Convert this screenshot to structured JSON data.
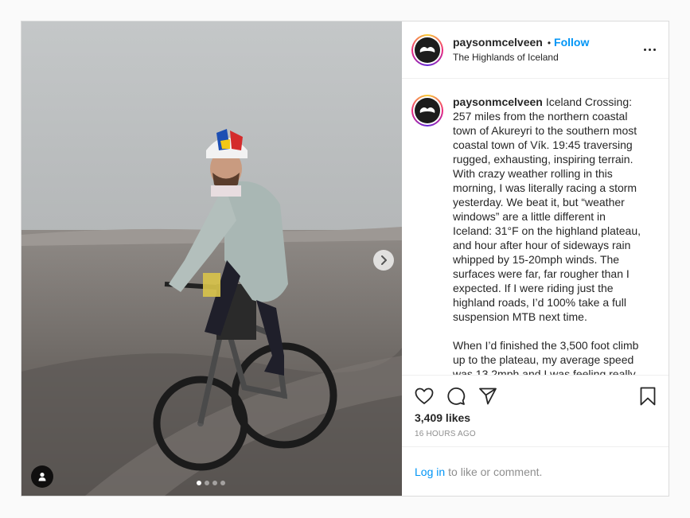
{
  "post": {
    "username": "paysonmcelveen",
    "bullet": "•",
    "follow_label": "Follow",
    "location": "The Highlands of Iceland",
    "caption_paragraphs": [
      "Iceland Crossing: 257 miles from the northern coastal town of Akureyri to the southern most coastal town of Vík. 19:45 traversing rugged, exhausting, inspiring terrain. With crazy weather rolling in this morning, I was literally racing a storm yesterday. We beat it, but “weather windows” are a little different in Iceland: 31°F on the highland plateau, and hour after hour of sideways rain whipped by 15-20mph winds. The surfaces were far, far rougher than I expected. If I were riding just the highland roads, I’d 100% take a full suspension MTB next time.",
      "When I’d finished the 3,500 foot climb up to the plateau, my average speed was 13.2mph and I was feeling really"
    ],
    "likes": "3,409 likes",
    "timestamp": "16 HOURS AGO",
    "login_label": "Log in",
    "comment_prompt": "to like or comment."
  },
  "carousel": {
    "slide_count": 4,
    "active_index": 0
  },
  "icons": {
    "more": "more-options-icon",
    "like": "heart-icon",
    "comment": "comment-icon",
    "share": "share-icon",
    "save": "bookmark-icon",
    "next": "chevron-right-icon",
    "tag": "user-tag-icon",
    "avatar": "mustache-logo-icon"
  },
  "colors": {
    "accent": "#0095f6",
    "text": "#262626",
    "muted": "#8e8e8e",
    "border": "#dbdbdb"
  }
}
